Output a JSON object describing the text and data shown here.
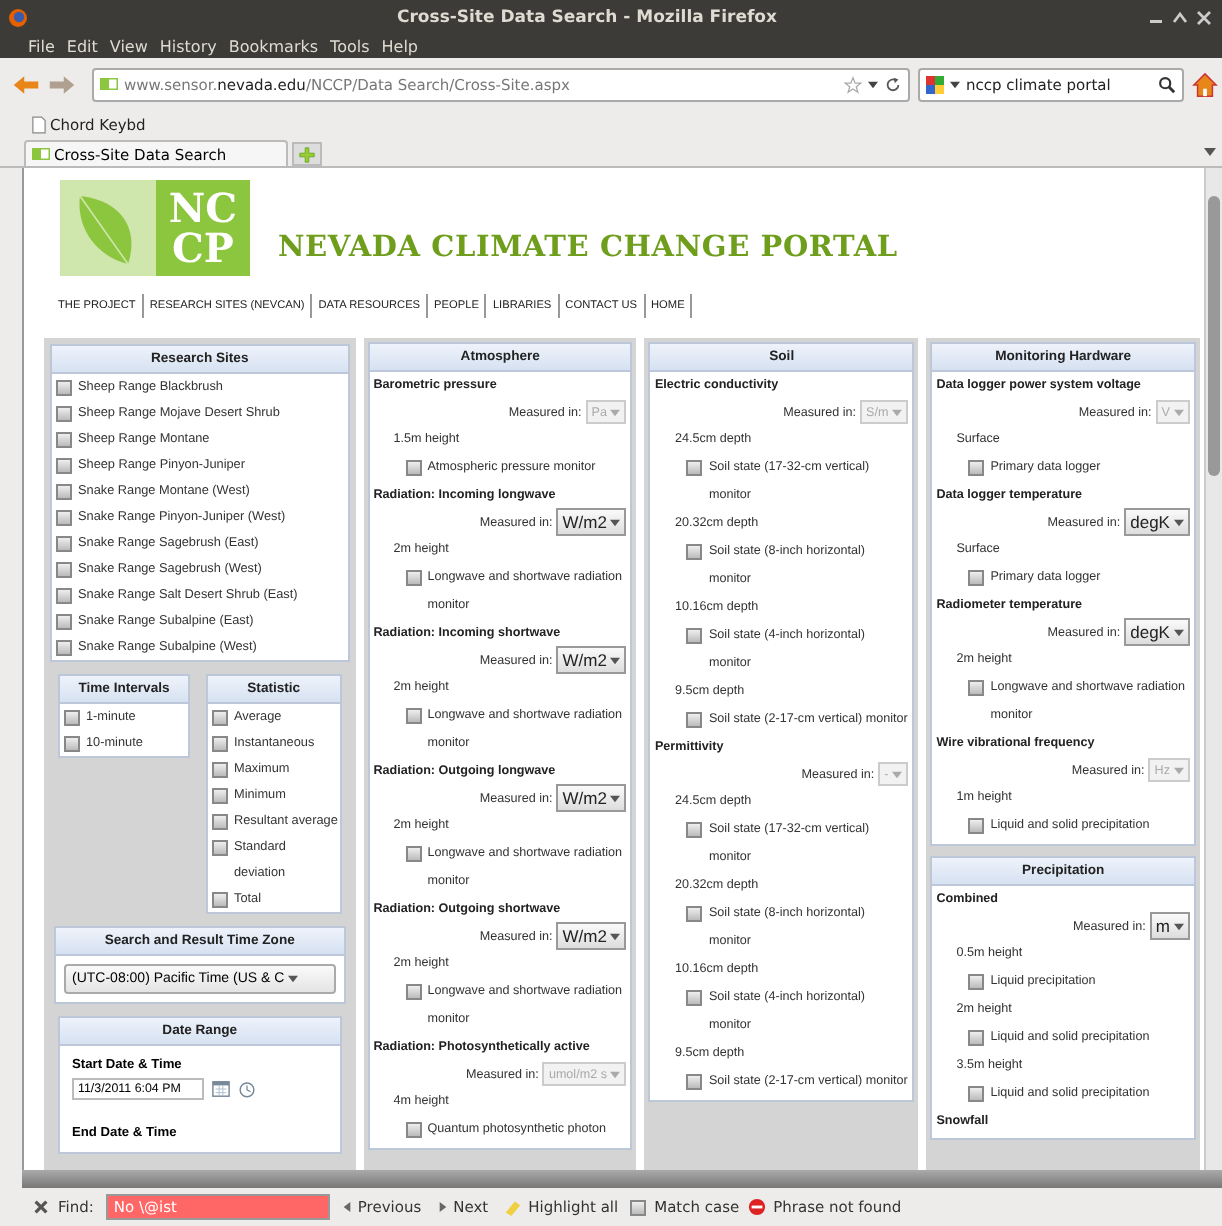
{
  "window": {
    "title": "Cross-Site Data Search - Mozilla Firefox"
  },
  "menu": [
    "File",
    "Edit",
    "View",
    "History",
    "Bookmarks",
    "Tools",
    "Help"
  ],
  "toolbar": {
    "url": "www.sensor.**nevada.edu**/NCCP/Data Search/Cross-Site.aspx",
    "search": "nccp climate portal"
  },
  "bookmarks": [
    "Chord Keybd"
  ],
  "tabs": [
    {
      "label": "Cross-Site Data Search",
      "selected": true
    }
  ],
  "site": {
    "logo_lines": [
      "NC",
      "CP"
    ],
    "title": "NEVADA CLIMATE CHANGE PORTAL",
    "nav": [
      "THE PROJECT",
      "RESEARCH SITES (NEVCAN)",
      "DATA RESOURCES",
      "PEOPLE",
      "LIBRARIES",
      "CONTACT US",
      "HOME"
    ]
  },
  "research_sites": {
    "title": "Research Sites",
    "items": [
      {
        "label": "Sheep Range Blackbrush",
        "checked": false
      },
      {
        "label": "Sheep Range Mojave Desert Shrub",
        "checked": false
      },
      {
        "label": "Sheep Range Montane",
        "checked": false
      },
      {
        "label": "Sheep Range Pinyon-Juniper",
        "checked": false
      },
      {
        "label": "Snake Range Montane (West)",
        "checked": false
      },
      {
        "label": "Snake Range Pinyon-Juniper (West)",
        "checked": false
      },
      {
        "label": "Snake Range Sagebrush (East)",
        "checked": false
      },
      {
        "label": "Snake Range Sagebrush (West)",
        "checked": false
      },
      {
        "label": "Snake Range Salt Desert Shrub (East)",
        "checked": false
      },
      {
        "label": "Snake Range Subalpine (East)",
        "checked": false
      },
      {
        "label": "Snake Range Subalpine (West)",
        "checked": false
      }
    ]
  },
  "time_intervals": {
    "title": "Time Intervals",
    "items": [
      {
        "label": "1-minute",
        "checked": false
      },
      {
        "label": "10-minute",
        "checked": false
      }
    ]
  },
  "statistic": {
    "title": "Statistic",
    "items": [
      {
        "label": "Average",
        "checked": false
      },
      {
        "label": "Instantaneous",
        "checked": false
      },
      {
        "label": "Maximum",
        "checked": false
      },
      {
        "label": "Minimum",
        "checked": false
      },
      {
        "label": "Resultant average",
        "checked": false
      },
      {
        "label": "Standard deviation",
        "checked": false
      },
      {
        "label": "Total",
        "checked": false
      }
    ]
  },
  "time_zone": {
    "title": "Search and Result Time Zone",
    "value": "(UTC-08:00) Pacific Time (US & C"
  },
  "date_range": {
    "title": "Date Range",
    "start_label": "Start Date & Time",
    "start_value": "11/3/2011 6:04 PM",
    "end_label": "End Date & Time"
  },
  "columns": [
    {
      "panels": [
        {
          "title": "Atmosphere",
          "groups": [
            {
              "name": "Barometric pressure",
              "measured_label": "Measured in:",
              "unit": "Pa",
              "unit_enabled": false,
              "locations": [
                {
                  "label": "1.5m height",
                  "sensors": [
                    {
                      "label": "Atmospheric pressure monitor",
                      "checked": false
                    }
                  ]
                }
              ]
            },
            {
              "name": "Radiation: Incoming longwave",
              "measured_label": "Measured in:",
              "unit": "W/m2",
              "unit_enabled": true,
              "locations": [
                {
                  "label": "2m height",
                  "sensors": [
                    {
                      "label": "Longwave and shortwave radiation monitor",
                      "checked": false
                    }
                  ]
                }
              ]
            },
            {
              "name": "Radiation: Incoming shortwave",
              "measured_label": "Measured in:",
              "unit": "W/m2",
              "unit_enabled": true,
              "locations": [
                {
                  "label": "2m height",
                  "sensors": [
                    {
                      "label": "Longwave and shortwave radiation monitor",
                      "checked": false
                    }
                  ]
                }
              ]
            },
            {
              "name": "Radiation: Outgoing longwave",
              "measured_label": "Measured in:",
              "unit": "W/m2",
              "unit_enabled": true,
              "locations": [
                {
                  "label": "2m height",
                  "sensors": [
                    {
                      "label": "Longwave and shortwave radiation monitor",
                      "checked": false
                    }
                  ]
                }
              ]
            },
            {
              "name": "Radiation: Outgoing shortwave",
              "measured_label": "Measured in:",
              "unit": "W/m2",
              "unit_enabled": true,
              "locations": [
                {
                  "label": "2m height",
                  "sensors": [
                    {
                      "label": "Longwave and shortwave radiation monitor",
                      "checked": false
                    }
                  ]
                }
              ]
            },
            {
              "name": "Radiation: Photosynthetically active",
              "measured_label": "Measured in:",
              "unit": "umol/m2 s",
              "unit_enabled": false,
              "locations": [
                {
                  "label": "4m height",
                  "sensors": [
                    {
                      "label": "Quantum photosynthetic photon",
                      "checked": false
                    }
                  ]
                }
              ]
            }
          ]
        }
      ]
    },
    {
      "panels": [
        {
          "title": "Soil",
          "groups": [
            {
              "name": "Electric conductivity",
              "measured_label": "Measured in:",
              "unit": "S/m",
              "unit_enabled": false,
              "locations": [
                {
                  "label": "24.5cm depth",
                  "sensors": [
                    {
                      "label": "Soil state (17-32-cm vertical) monitor",
                      "checked": false
                    }
                  ]
                },
                {
                  "label": "20.32cm depth",
                  "sensors": [
                    {
                      "label": "Soil state (8-inch horizontal) monitor",
                      "checked": false
                    }
                  ]
                },
                {
                  "label": "10.16cm depth",
                  "sensors": [
                    {
                      "label": "Soil state (4-inch horizontal) monitor",
                      "checked": false
                    }
                  ]
                },
                {
                  "label": "9.5cm depth",
                  "sensors": [
                    {
                      "label": "Soil state (2-17-cm vertical) monitor",
                      "checked": false
                    }
                  ]
                }
              ]
            },
            {
              "name": "Permittivity",
              "measured_label": "Measured in:",
              "unit": "-",
              "unit_enabled": false,
              "locations": [
                {
                  "label": "24.5cm depth",
                  "sensors": [
                    {
                      "label": "Soil state (17-32-cm vertical) monitor",
                      "checked": false
                    }
                  ]
                },
                {
                  "label": "20.32cm depth",
                  "sensors": [
                    {
                      "label": "Soil state (8-inch horizontal) monitor",
                      "checked": false
                    }
                  ]
                },
                {
                  "label": "10.16cm depth",
                  "sensors": [
                    {
                      "label": "Soil state (4-inch horizontal) monitor",
                      "checked": false
                    }
                  ]
                },
                {
                  "label": "9.5cm depth",
                  "sensors": [
                    {
                      "label": "Soil state (2-17-cm vertical) monitor",
                      "checked": false
                    }
                  ]
                }
              ]
            }
          ]
        }
      ]
    },
    {
      "panels": [
        {
          "title": "Monitoring Hardware",
          "groups": [
            {
              "name": "Data logger power system voltage",
              "measured_label": "Measured in:",
              "unit": "V",
              "unit_enabled": false,
              "locations": [
                {
                  "label": "Surface",
                  "sensors": [
                    {
                      "label": "Primary data logger",
                      "checked": false
                    }
                  ]
                }
              ]
            },
            {
              "name": "Data logger temperature",
              "measured_label": "Measured in:",
              "unit": "degK",
              "unit_enabled": true,
              "locations": [
                {
                  "label": "Surface",
                  "sensors": [
                    {
                      "label": "Primary data logger",
                      "checked": false
                    }
                  ]
                }
              ]
            },
            {
              "name": "Radiometer temperature",
              "measured_label": "Measured in:",
              "unit": "degK",
              "unit_enabled": true,
              "locations": [
                {
                  "label": "2m height",
                  "sensors": [
                    {
                      "label": "Longwave and shortwave radiation monitor",
                      "checked": false
                    }
                  ]
                }
              ]
            },
            {
              "name": "Wire vibrational frequency",
              "measured_label": "Measured in:",
              "unit": "Hz",
              "unit_enabled": false,
              "locations": [
                {
                  "label": "1m height",
                  "sensors": [
                    {
                      "label": "Liquid and solid precipitation",
                      "checked": false
                    }
                  ]
                }
              ]
            }
          ]
        },
        {
          "title": "Precipitation",
          "groups": [
            {
              "name": "Combined",
              "measured_label": "Measured in:",
              "unit": "m",
              "unit_enabled": true,
              "locations": [
                {
                  "label": "0.5m height",
                  "sensors": [
                    {
                      "label": "Liquid precipitation",
                      "checked": false
                    }
                  ]
                },
                {
                  "label": "2m height",
                  "sensors": [
                    {
                      "label": "Liquid and solid precipitation",
                      "checked": false
                    }
                  ]
                },
                {
                  "label": "3.5m height",
                  "sensors": [
                    {
                      "label": "Liquid and solid precipitation",
                      "checked": false
                    }
                  ]
                }
              ]
            },
            {
              "name": "Snowfall"
            }
          ]
        }
      ]
    }
  ],
  "find_bar": {
    "label": "Find:",
    "value": "No \\@ist",
    "not_found": true,
    "previous": "Previous",
    "next": "Next",
    "highlight": "Highlight all",
    "match_case": {
      "label": "Match case",
      "checked": false
    },
    "status": "Phrase not found"
  }
}
